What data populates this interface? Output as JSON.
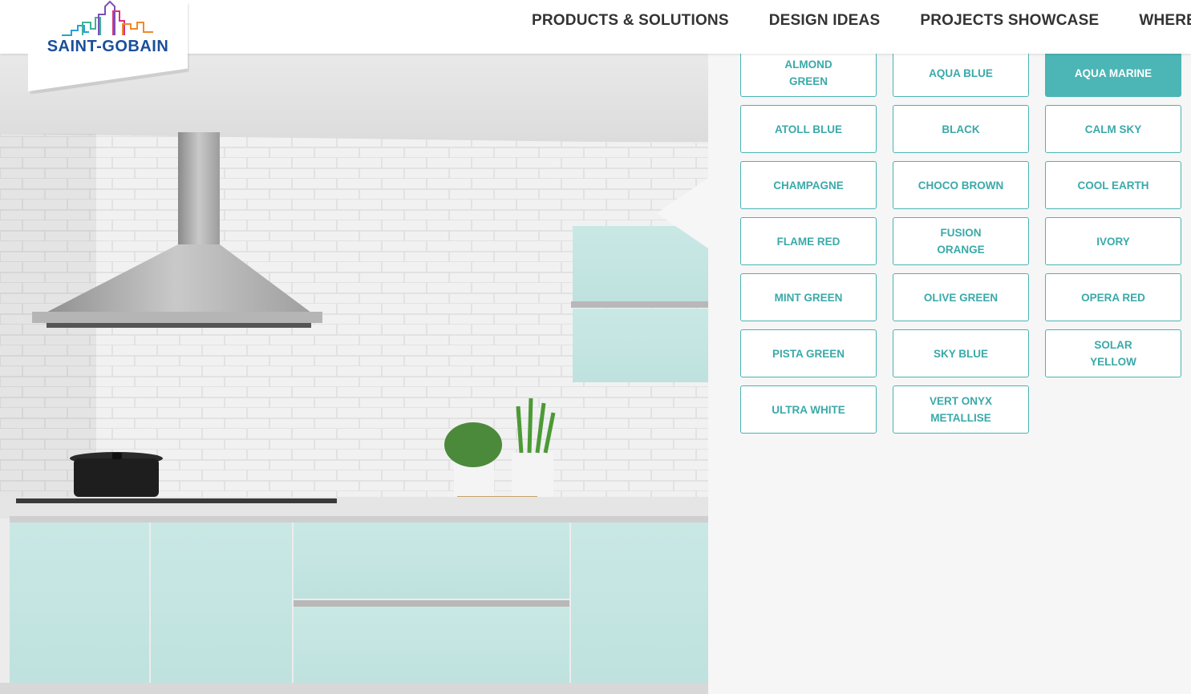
{
  "brand": {
    "logo_text": "SAINT-GOBAIN"
  },
  "nav": {
    "items": [
      "PRODUCTS & SOLUTIONS",
      "DESIGN IDEAS",
      "PROJECTS SHOWCASE",
      "WHERE TO"
    ]
  },
  "colors": {
    "accent": "#4cb5b5",
    "cabinet_tint": "#c7e6e3",
    "logo_blue": "#1a4f9c"
  },
  "swatches": {
    "selected": "AQUA MARINE",
    "items": [
      "ALMOND GREEN",
      "AQUA BLUE",
      "AQUA MARINE",
      "ATOLL BLUE",
      "BLACK",
      "CALM SKY",
      "CHAMPAGNE",
      "CHOCO BROWN",
      "COOL EARTH",
      "FLAME RED",
      "FUSION ORANGE",
      "IVORY",
      "MINT GREEN",
      "OLIVE GREEN",
      "OPERA RED",
      "PISTA GREEN",
      "SKY BLUE",
      "SOLAR YELLOW",
      "ULTRA WHITE",
      "VERT ONYX METALLISE"
    ]
  }
}
